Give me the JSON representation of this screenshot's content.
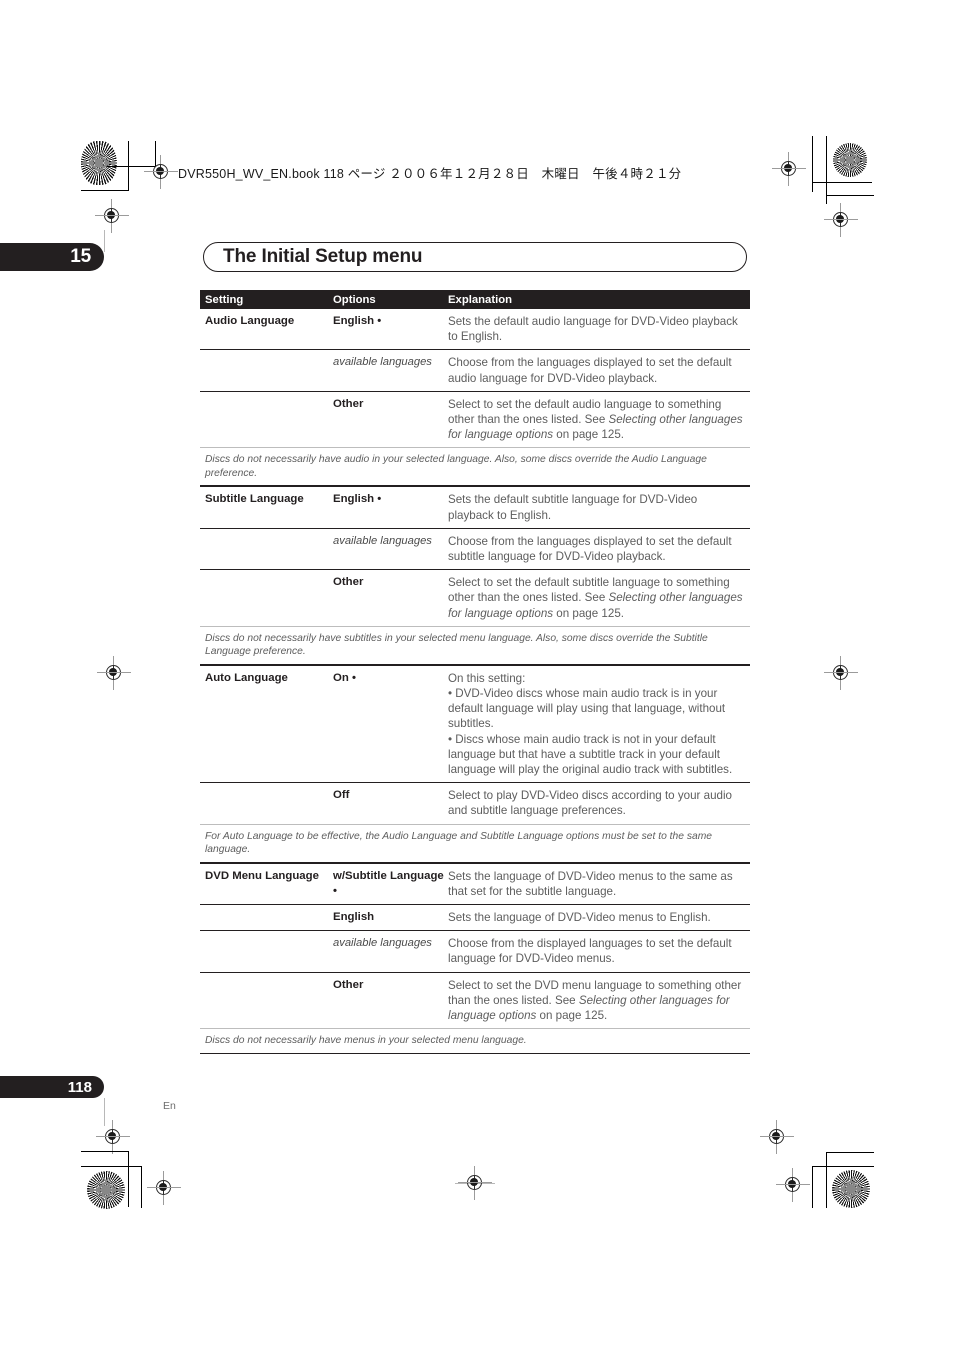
{
  "print_marks": {
    "header_filestamp": "DVR550H_WV_EN.book  118 ページ  ２００６年１２月２８日　木曜日　午後４時２１分"
  },
  "chapter": {
    "number": "15",
    "title": "The Initial Setup menu"
  },
  "table": {
    "headers": [
      "Setting",
      "Options",
      "Explanation"
    ],
    "groups": [
      {
        "setting": "Audio Language",
        "rows": [
          {
            "option": "English •",
            "option_style": "bold",
            "explanation": "Sets the default audio language for DVD-Video playback to English."
          },
          {
            "option": "available languages",
            "option_style": "italic",
            "explanation": "Choose from the languages displayed to set the default audio language for DVD-Video playback."
          },
          {
            "option": "Other",
            "option_style": "bold",
            "explanation_pre": "Select to set the default audio language to something other than the ones listed. See ",
            "explanation_italic": "Selecting other languages for language options",
            "explanation_post": " on page 125."
          }
        ],
        "note": "Discs do not necessarily have audio in your selected language. Also, some discs override the Audio Language preference."
      },
      {
        "setting": "Subtitle Language",
        "rows": [
          {
            "option": "English •",
            "option_style": "bold",
            "explanation": "Sets the default subtitle language for DVD-Video playback to English."
          },
          {
            "option": "available languages",
            "option_style": "italic",
            "explanation": "Choose from the languages displayed to set the default subtitle language for DVD-Video playback."
          },
          {
            "option": "Other",
            "option_style": "bold",
            "explanation_pre": "Select to set the default subtitle language to something other than the ones listed. See ",
            "explanation_italic": "Selecting other languages for language options",
            "explanation_post": " on page 125."
          }
        ],
        "note": "Discs do not necessarily have subtitles in your selected menu language. Also, some discs override the Subtitle Language preference."
      },
      {
        "setting": "Auto Language",
        "rows": [
          {
            "option": "On •",
            "option_style": "bold",
            "explanation": "On this setting:\n• DVD-Video discs whose main audio track is in your default language will play using that language, without subtitles.\n• Discs whose main audio track is not in your default language but that have a subtitle track in your default language will play the original audio track with subtitles."
          },
          {
            "option": "Off",
            "option_style": "bold",
            "explanation": "Select to play DVD-Video discs according to your audio and subtitle language preferences."
          }
        ],
        "note": "For Auto Language to be effective, the Audio Language and Subtitle Language options must be set to the same language."
      },
      {
        "setting": "DVD Menu Language",
        "rows": [
          {
            "option": "w/Subtitle Language •",
            "option_style": "bold",
            "explanation": "Sets the language of DVD-Video menus to the same as that set for the subtitle language."
          },
          {
            "option": "English",
            "option_style": "bold",
            "explanation": "Sets the language of DVD-Video menus to English."
          },
          {
            "option": "available languages",
            "option_style": "italic",
            "explanation": "Choose from the displayed languages to set the default language for DVD-Video menus."
          },
          {
            "option": "Other",
            "option_style": "bold",
            "explanation_pre": "Select to set the DVD menu language to something other than the ones listed. See ",
            "explanation_italic": "Selecting other languages for language options",
            "explanation_post": " on page 125."
          }
        ],
        "note": "Discs do not necessarily have menus in your selected menu language."
      }
    ]
  },
  "footer": {
    "page_number": "118",
    "language_code": "En"
  },
  "colors": {
    "ink": "#231f20",
    "body_text": "#5d5d5d",
    "rule": "#231f20",
    "light_rule": "#bdbdbd"
  }
}
